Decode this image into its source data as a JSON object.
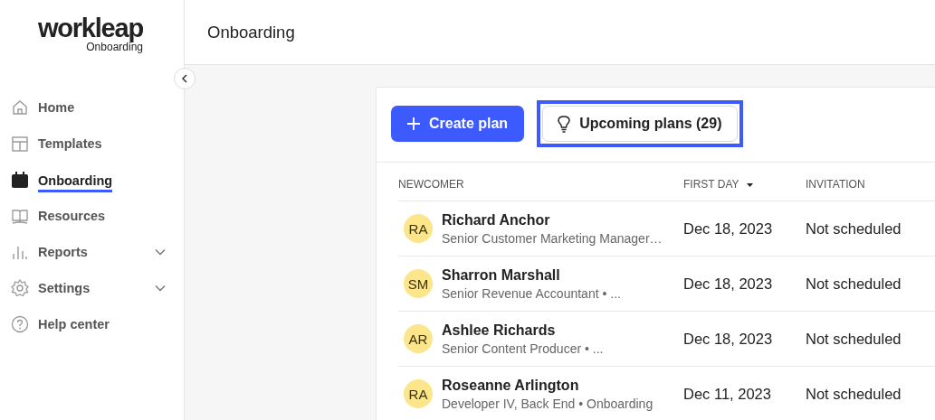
{
  "brand": {
    "name": "workleap",
    "product": "Onboarding"
  },
  "sidebar": {
    "items": [
      {
        "label": "Home",
        "kind": "link",
        "selected": false
      },
      {
        "label": "Templates",
        "kind": "link",
        "selected": false
      },
      {
        "label": "Onboarding",
        "kind": "link",
        "selected": true
      },
      {
        "label": "Resources",
        "kind": "link",
        "selected": false
      },
      {
        "label": "Reports",
        "kind": "group",
        "selected": false
      },
      {
        "label": "Settings",
        "kind": "group",
        "selected": false
      },
      {
        "label": "Help center",
        "kind": "link",
        "selected": false
      }
    ]
  },
  "header": {
    "title": "Onboarding"
  },
  "toolbar": {
    "create_button": "Create plan",
    "upcoming_button": {
      "label": "Upcoming plans (29)",
      "highlighted": true
    }
  },
  "table": {
    "columns": [
      {
        "label": "NEWCOMER",
        "sorted": false
      },
      {
        "label": "FIRST DAY",
        "sorted": true
      },
      {
        "label": "INVITATION",
        "sorted": false
      }
    ],
    "rows": [
      {
        "initials": "RA",
        "name": "Richard Anchor",
        "subtitle": "Senior Customer Marketing Manager…",
        "first_day": "Dec 18, 2023",
        "invitation": "Not scheduled"
      },
      {
        "initials": "SM",
        "name": "Sharron Marshall",
        "subtitle": "Senior Revenue Accountant •  ...",
        "first_day": "Dec 18, 2023",
        "invitation": "Not scheduled"
      },
      {
        "initials": "AR",
        "name": "Ashlee Richards",
        "subtitle": "Senior Content Producer •  ...",
        "first_day": "Dec 18, 2023",
        "invitation": "Not scheduled"
      },
      {
        "initials": "RA",
        "name": "Roseanne Arlington",
        "subtitle": "Developer IV, Back End • Onboarding",
        "first_day": "Dec 11, 2023",
        "invitation": "Not scheduled"
      }
    ]
  }
}
